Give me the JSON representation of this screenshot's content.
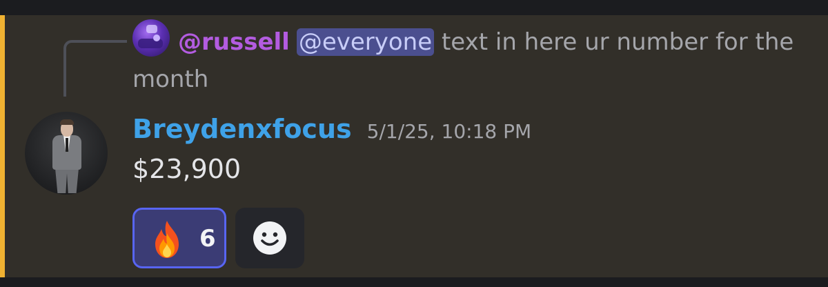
{
  "reply": {
    "username": "@russell",
    "mention": "@everyone",
    "text": " text in here ur number for the month"
  },
  "message": {
    "username": "Breydenxfocus",
    "timestamp": "5/1/25, 10:18 PM",
    "content": "$23,900"
  },
  "reactions": [
    {
      "emoji": "fire-icon",
      "count": "6",
      "selected": true
    }
  ],
  "add_reaction": {
    "icon": "smiley-icon"
  },
  "colors": {
    "mention_highlight_bar": "#f0b232",
    "message_background": "#322f29",
    "username": "#3fa2e8",
    "reply_username": "#b35ce0",
    "reaction_selected_border": "#5865f2",
    "reaction_selected_bg": "#3b3c75"
  }
}
